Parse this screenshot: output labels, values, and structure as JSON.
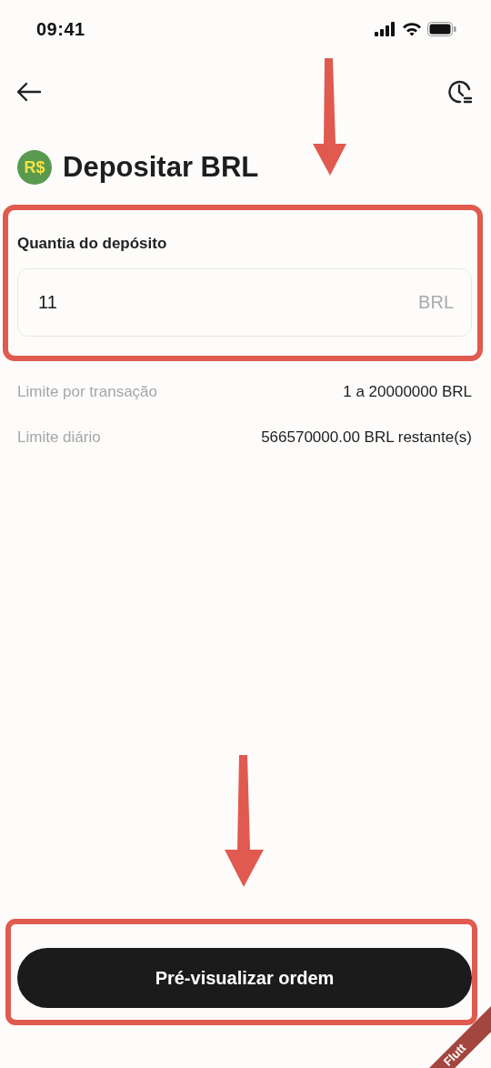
{
  "status_bar": {
    "time": "09:41"
  },
  "title": "Depositar BRL",
  "currency_badge": "R$",
  "amount_field": {
    "label": "Quantia do depósito",
    "value": "11",
    "suffix": "BRL"
  },
  "limits": [
    {
      "label": "Limite por transação",
      "value": "1 a 20000000 BRL"
    },
    {
      "label": "Limite diário",
      "value": "566570000.00 BRL restante(s)"
    }
  ],
  "primary_button": "Pré-visualizar ordem",
  "debug_banner": "Flutt"
}
